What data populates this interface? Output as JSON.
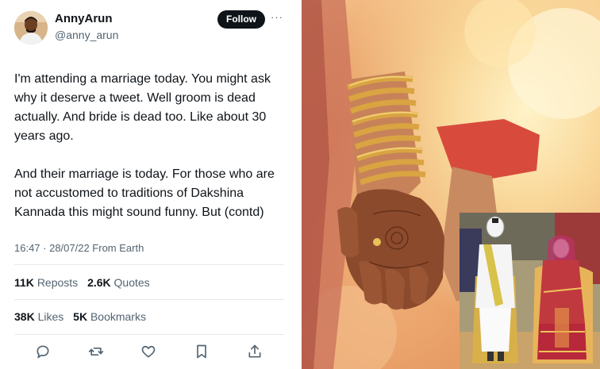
{
  "tweet": {
    "display_name": "AnnyArun",
    "handle": "@anny_arun",
    "follow_label": "Follow",
    "more_icon": "more-horizontal-icon",
    "paragraph_1": "I'm attending a marriage today. You might ask why it deserve a tweet. Well groom is dead actually. And bride is dead too. Like about 30 years ago.",
    "paragraph_2": "And their marriage is today. For those who are not accustomed to traditions of Dakshina Kannada this might sound funny. But (contd)",
    "timestamp": "16:47 · 28/07/22 From Earth",
    "reposts_count": "11K",
    "reposts_label": "Reposts",
    "quotes_count": "2.6K",
    "quotes_label": "Quotes",
    "likes_count": "38K",
    "likes_label": "Likes",
    "bookmarks_count": "5K",
    "bookmarks_label": "Bookmarks",
    "actions": [
      "reply-icon",
      "repost-icon",
      "like-icon",
      "bookmark-icon",
      "share-icon"
    ]
  },
  "colors": {
    "text_primary": "#0f1419",
    "text_secondary": "#536471",
    "follow_bg": "#0f1419",
    "divider": "#e6e9ec"
  },
  "photos": {
    "main": "holding-hands-bangles-photo",
    "inset": "bride-groom-dolls-photo"
  }
}
